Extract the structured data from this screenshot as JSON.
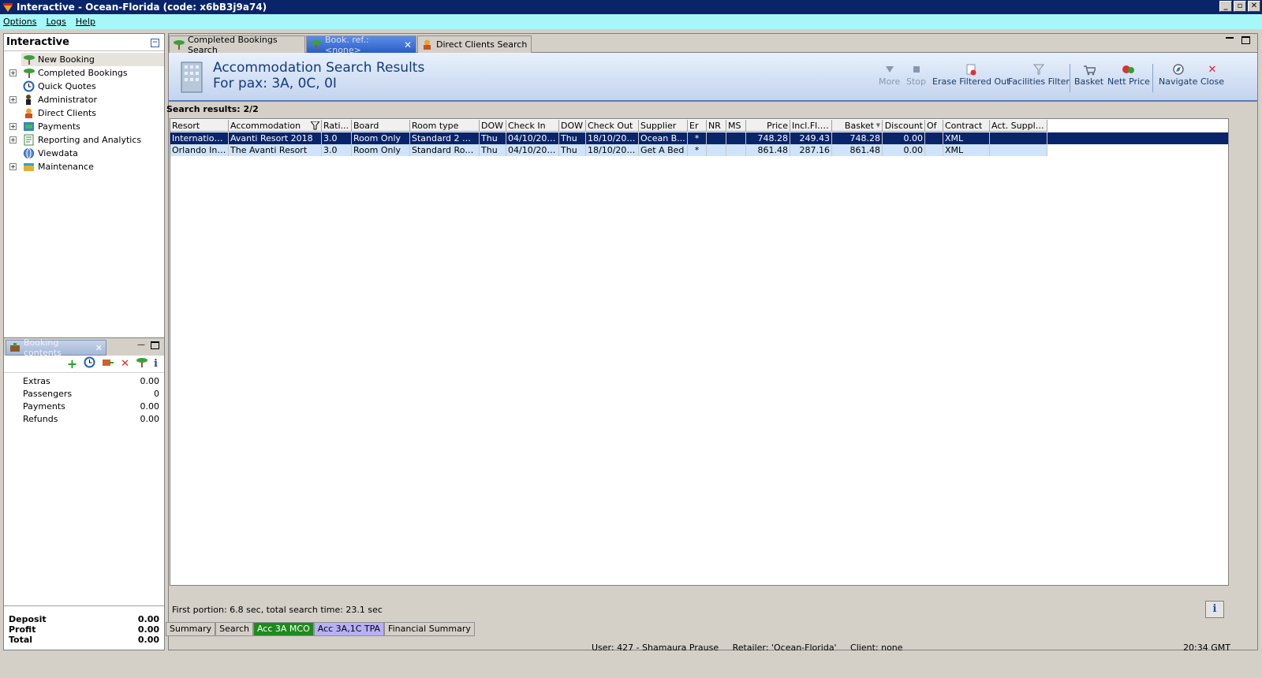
{
  "window": {
    "title": "Interactive - Ocean-Florida (code: x6bB3j9a74)",
    "minimize": "_",
    "restore": "▫",
    "close": "✕"
  },
  "menu": [
    "Options",
    "Logs",
    "Help"
  ],
  "left_panel": {
    "title": "Interactive",
    "collapse": "−",
    "items": [
      {
        "label": "New Booking",
        "icon": "palm-tree-icon",
        "expandable": false
      },
      {
        "label": "Completed Bookings",
        "icon": "palm-tree-icon",
        "expandable": true
      },
      {
        "label": "Quick Quotes",
        "icon": "clock-icon",
        "expandable": false
      },
      {
        "label": "Administrator",
        "icon": "person-icon",
        "expandable": true
      },
      {
        "label": "Direct Clients",
        "icon": "client-icon",
        "expandable": false
      },
      {
        "label": "Payments",
        "icon": "payments-icon",
        "expandable": true
      },
      {
        "label": "Reporting and Analytics",
        "icon": "report-icon",
        "expandable": true
      },
      {
        "label": "Viewdata",
        "icon": "globe-icon",
        "expandable": false
      },
      {
        "label": "Maintenance",
        "icon": "toolbox-icon",
        "expandable": true
      }
    ]
  },
  "booking_contents": {
    "tab_label": "Booking contents",
    "rows": [
      {
        "label": "Extras",
        "value": "0.00"
      },
      {
        "label": "Passengers",
        "value": "0"
      },
      {
        "label": "Payments",
        "value": "0.00"
      },
      {
        "label": "Refunds",
        "value": "0.00"
      }
    ],
    "totals": [
      {
        "label": "Deposit",
        "value": "0.00"
      },
      {
        "label": "Profit",
        "value": "0.00"
      },
      {
        "label": "Total",
        "value": "0.00"
      }
    ]
  },
  "tabs": [
    {
      "label": "Completed Bookings Search",
      "active": false
    },
    {
      "label": "Book. ref.: <none>",
      "active": true
    },
    {
      "label": "Direct Clients Search",
      "active": false
    }
  ],
  "header": {
    "title": "Accommodation Search Results",
    "subtitle": "For pax: 3A, 0C, 0I"
  },
  "toolbar": {
    "more": "More",
    "stop": "Stop",
    "erase": "Erase Filtered Out",
    "facilities": "Facilities Filter",
    "basket": "Basket",
    "nett_price": "Nett Price",
    "navigate": "Navigate",
    "close": "Close"
  },
  "results": {
    "label": "Search results: 2/2",
    "columns": [
      "Resort",
      "Accommodation",
      "Rati...",
      "Board",
      "Room type",
      "DOW",
      "Check In",
      "DOW",
      "Check Out",
      "Supplier",
      "Er",
      "NR",
      "MS",
      "Price",
      "Incl.Fl.PP",
      "Basket",
      "Discount",
      "Of",
      "Contract",
      "Act. Supplier"
    ],
    "rows": [
      [
        "Internation...",
        "Avanti Resort 2018",
        "3.0",
        "Room Only",
        "Standard 2 Qu...",
        "Thu",
        "04/10/2018",
        "Thu",
        "18/10/2018",
        "Ocean B...",
        "*",
        "",
        "",
        "748.28",
        "249.43",
        "748.28",
        "0.00",
        "",
        "XML",
        ""
      ],
      [
        "Orlando Int...",
        "The Avanti Resort",
        "3.0",
        "Room Only",
        "Standard Room C",
        "Thu",
        "04/10/2018",
        "Thu",
        "18/10/2018",
        "Get A Bed",
        "*",
        "",
        "",
        "861.48",
        "287.16",
        "861.48",
        "0.00",
        "",
        "XML",
        ""
      ]
    ]
  },
  "status_line": "First portion: 6.8 sec, total search time: 23.1 sec",
  "info_button": "i",
  "bottom_tabs": [
    {
      "label": "Summary",
      "style": "normal"
    },
    {
      "label": "Search",
      "style": "normal"
    },
    {
      "label": "Acc 3A MCO",
      "style": "green"
    },
    {
      "label": "Acc 3A,1C TPA",
      "style": "blue"
    },
    {
      "label": "Financial Summary",
      "style": "normal"
    }
  ],
  "footer": {
    "user": "User: 427 - Shamaura Prause     Retailer: 'Ocean-Florida'     Client: none",
    "time": "20:34 GMT"
  },
  "colors": {
    "title_bar": "#0a246a",
    "menu_bar": "#a6f7f7",
    "selected_row": "#0a246a",
    "alt_row": "#cfe4fa",
    "green_tab": "#1e8a1e",
    "blue_tab": "#b8b0f4"
  }
}
